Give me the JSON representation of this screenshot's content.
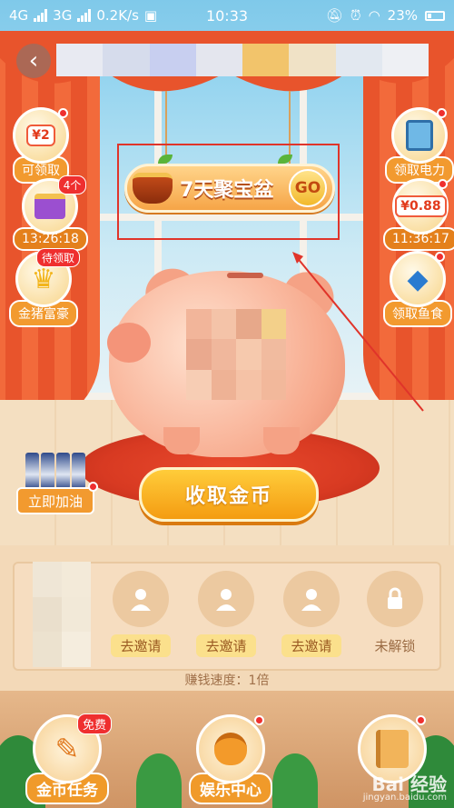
{
  "status_bar": {
    "network_1": "4G",
    "network_2": "3G",
    "speed": "0.2K/s",
    "time": "10:33",
    "battery": "23%"
  },
  "header": {
    "back_icon": "chevron-left-icon"
  },
  "left_widgets": [
    {
      "tag": "¥2",
      "label": "可领取"
    },
    {
      "badge": "4个",
      "label": "13:26:18"
    },
    {
      "badge": "待领取",
      "label": "金猪富豪"
    }
  ],
  "right_widgets": [
    {
      "label": "领取电力"
    },
    {
      "tag": "¥0.88",
      "label": "11:36:17"
    },
    {
      "label": "领取鱼食"
    }
  ],
  "banner": {
    "text": "7天聚宝盆",
    "go": "GO"
  },
  "collect_button": "收取金币",
  "fuel_button": "立即加油",
  "invite_slots": [
    {
      "label": "去邀请"
    },
    {
      "label": "去邀请"
    },
    {
      "label": "去邀请"
    },
    {
      "label": "未解锁"
    }
  ],
  "speed_text": "赚钱速度：1倍",
  "bottom_nav": [
    {
      "label": "金币任务",
      "badge": "免费"
    },
    {
      "label": "娱乐中心"
    },
    {
      "label": ""
    }
  ],
  "watermark": {
    "text": "Bai 经验",
    "sub": "jingyan.baidu.com"
  },
  "colors": {
    "accent_orange": "#f29a2f",
    "badge_red": "#ef2f2f",
    "highlight_box": "#e0342a"
  }
}
